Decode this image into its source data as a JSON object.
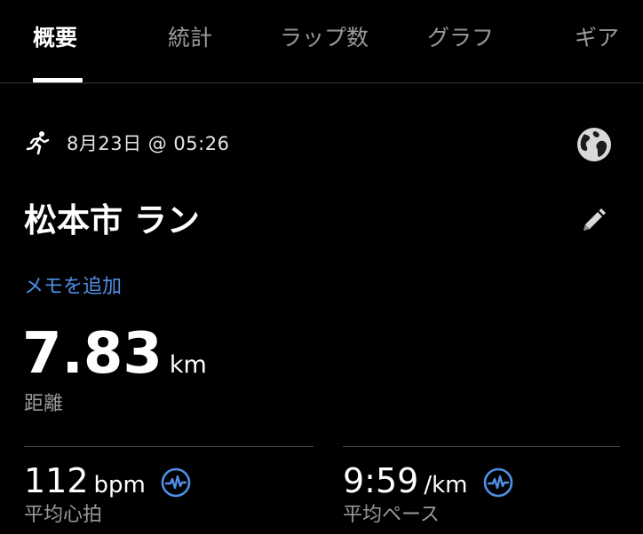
{
  "tabs": [
    {
      "label": "概要",
      "active": true
    },
    {
      "label": "統計",
      "active": false
    },
    {
      "label": "ラップ数",
      "active": false
    },
    {
      "label": "グラフ",
      "active": false
    },
    {
      "label": "ギア",
      "active": false
    }
  ],
  "activity": {
    "icon": "running-person-icon",
    "date_time": "8月23日 @ 05:26",
    "title": "松本市 ラン",
    "add_memo": "メモを追加"
  },
  "distance": {
    "value": "7.83",
    "unit": "km",
    "label": "距離"
  },
  "stats": [
    {
      "value": "112",
      "unit": "bpm",
      "label": "平均心拍",
      "icon": "heart-rate-icon"
    },
    {
      "value": "9:59",
      "unit": "/km",
      "label": "平均ペース",
      "icon": "heart-rate-icon"
    }
  ],
  "colors": {
    "background": "#000000",
    "accent": "#4f8fe6",
    "secondary_text": "#9a9a9e"
  }
}
